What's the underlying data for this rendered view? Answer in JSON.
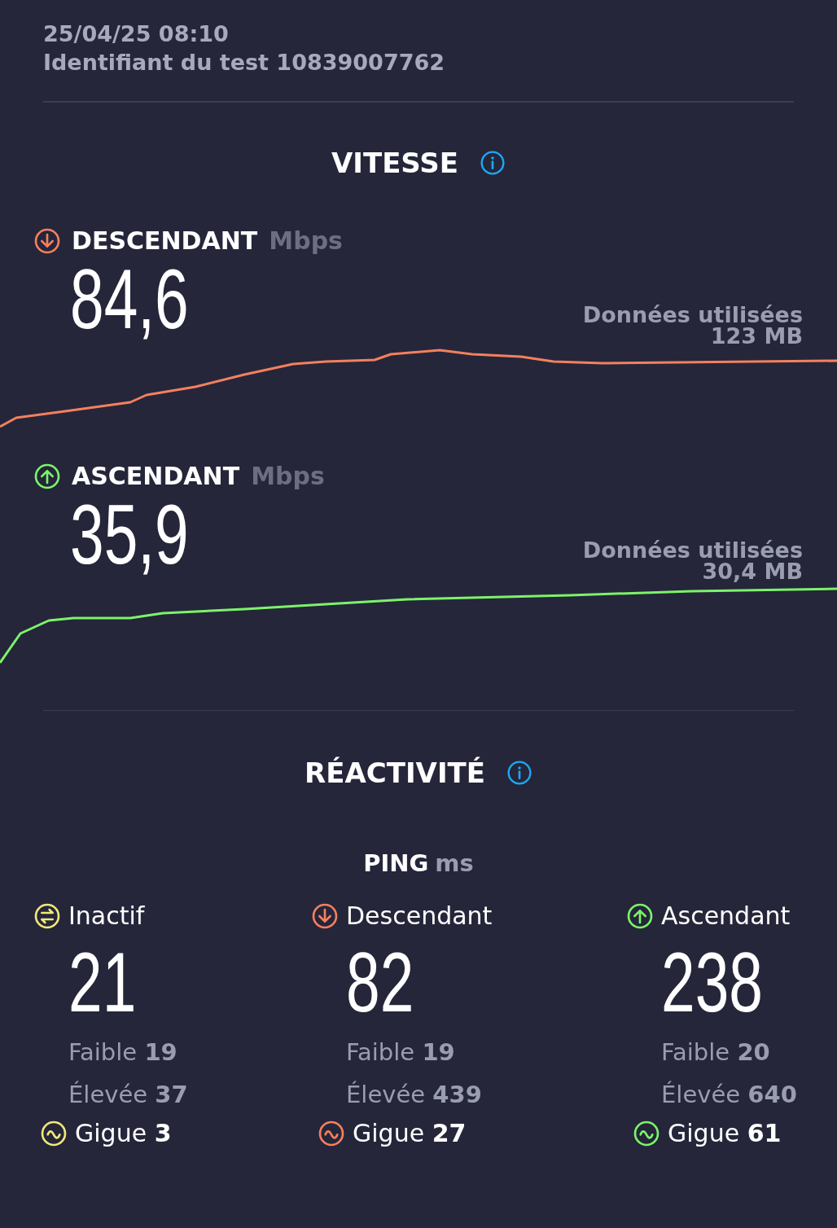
{
  "header": {
    "datetime": "25/04/25 08:10",
    "test_id": "Identifiant du test 10839007762"
  },
  "speed": {
    "title": "VITESSE",
    "tests": [
      {
        "kind": "down",
        "label": "DESCENDANT",
        "unit": "Mbps",
        "value": "84,6",
        "data_label": "Données utilisées",
        "data_value": "123 MB",
        "color": "#f4805e"
      },
      {
        "kind": "up",
        "label": "ASCENDANT",
        "unit": "Mbps",
        "value": "35,9",
        "data_label": "Données utilisées",
        "data_value": "30,4 MB",
        "color": "#7cf36a"
      }
    ]
  },
  "responsiveness": {
    "title": "RÉACTIVITÉ",
    "ping_label": "PING",
    "ping_unit": "ms",
    "columns": [
      {
        "kind": "idle",
        "label": "Inactif",
        "value": "21",
        "low": "Faible **19**",
        "high": "Élevée **37**",
        "jitter": "Gigue **3**",
        "color": "#f2e77a"
      },
      {
        "kind": "down",
        "label": "Descendant",
        "value": "82",
        "low": "Faible **19**",
        "high": "Élevée **439**",
        "jitter": "Gigue **27**",
        "color": "#f4805e"
      },
      {
        "kind": "up",
        "label": "Ascendant",
        "value": "238",
        "low": "Faible **20**",
        "high": "Élevée **640**",
        "jitter": "Gigue **61**",
        "color": "#7cf36a"
      }
    ]
  }
}
